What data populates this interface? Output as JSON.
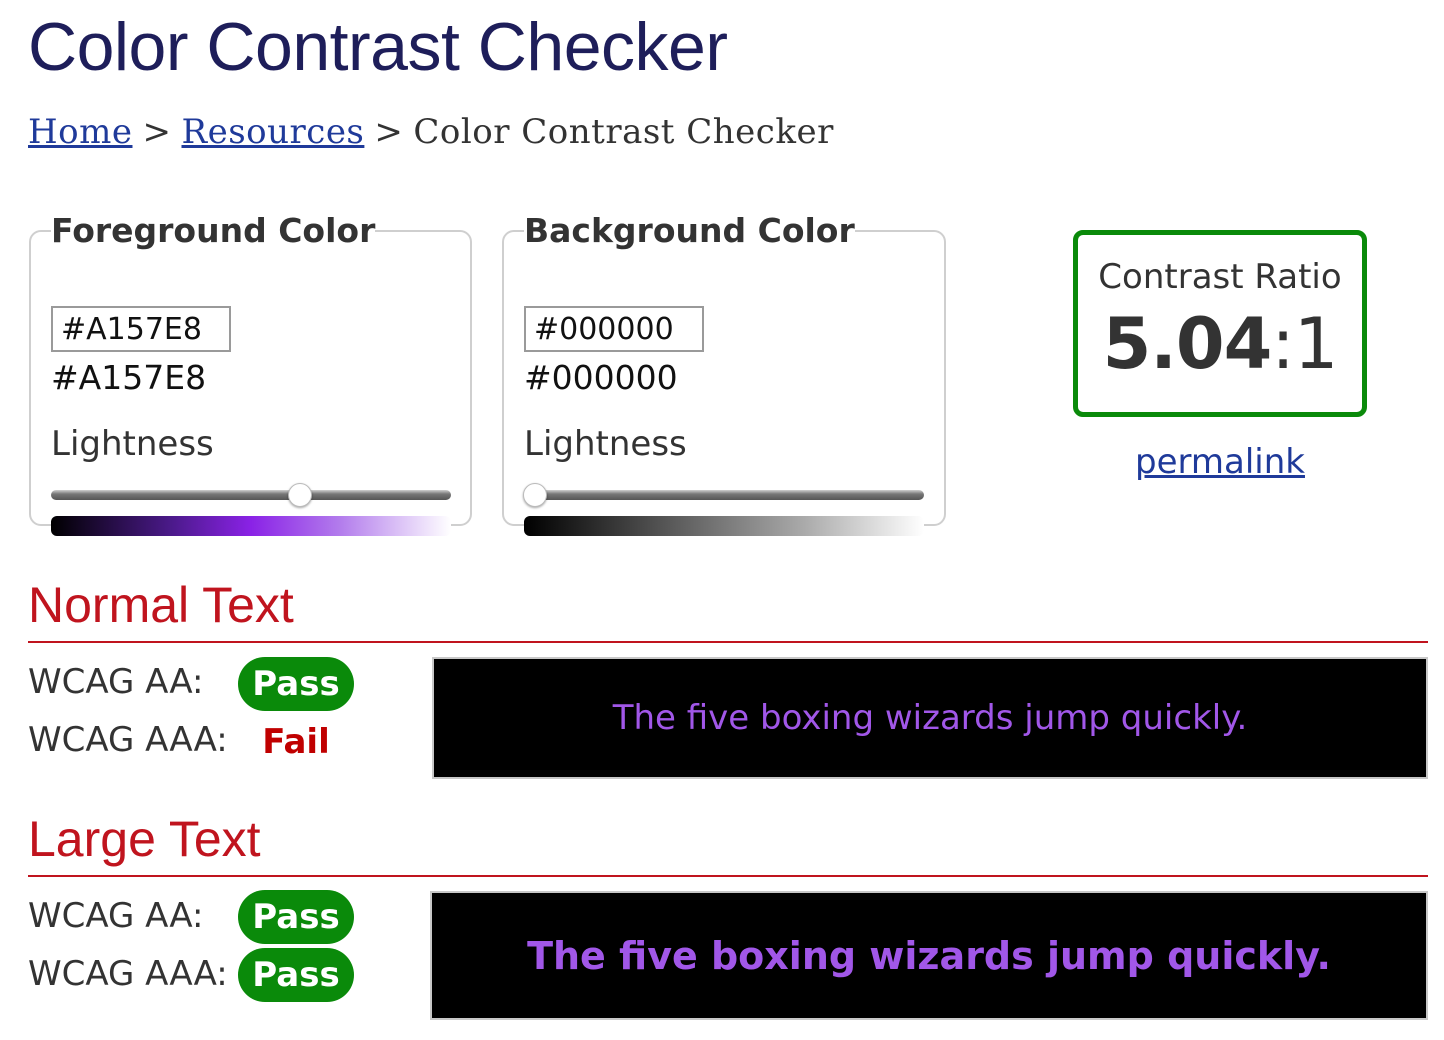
{
  "page": {
    "title": "Color Contrast Checker"
  },
  "breadcrumb": {
    "items": [
      {
        "label": "Home",
        "link": true
      },
      {
        "label": "Resources",
        "link": true
      },
      {
        "label": "Color Contrast Checker",
        "link": false
      }
    ],
    "separator": ">"
  },
  "foreground": {
    "legend": "Foreground Color",
    "input_value": "#A157E8",
    "hex_display": "#A157E8",
    "lightness_label": "Lightness",
    "lightness_percent": 62,
    "color": "#A157E8"
  },
  "background": {
    "legend": "Background Color",
    "input_value": "#000000",
    "hex_display": "#000000",
    "lightness_label": "Lightness",
    "lightness_percent": 0,
    "color": "#000000"
  },
  "contrast": {
    "label": "Contrast Ratio",
    "ratio": "5.04",
    "suffix": ":1",
    "border_color": "#0A8A0A",
    "permalink_label": "permalink"
  },
  "normal_text": {
    "heading": "Normal Text",
    "aa_label": "WCAG AA:",
    "aa_result": "Pass",
    "aaa_label": "WCAG AAA:",
    "aaa_result": "Fail",
    "sample": "The five boxing wizards jump quickly."
  },
  "large_text": {
    "heading": "Large Text",
    "aa_label": "WCAG AA:",
    "aa_result": "Pass",
    "aaa_label": "WCAG AAA:",
    "aaa_result": "Pass",
    "sample": "The five boxing wizards jump quickly."
  },
  "colors": {
    "heading_blue": "#1E1E5A",
    "section_red": "#C0141E",
    "pass_green": "#0A8A0A",
    "fail_red": "#C00000",
    "link_blue": "#1F3A9A"
  }
}
